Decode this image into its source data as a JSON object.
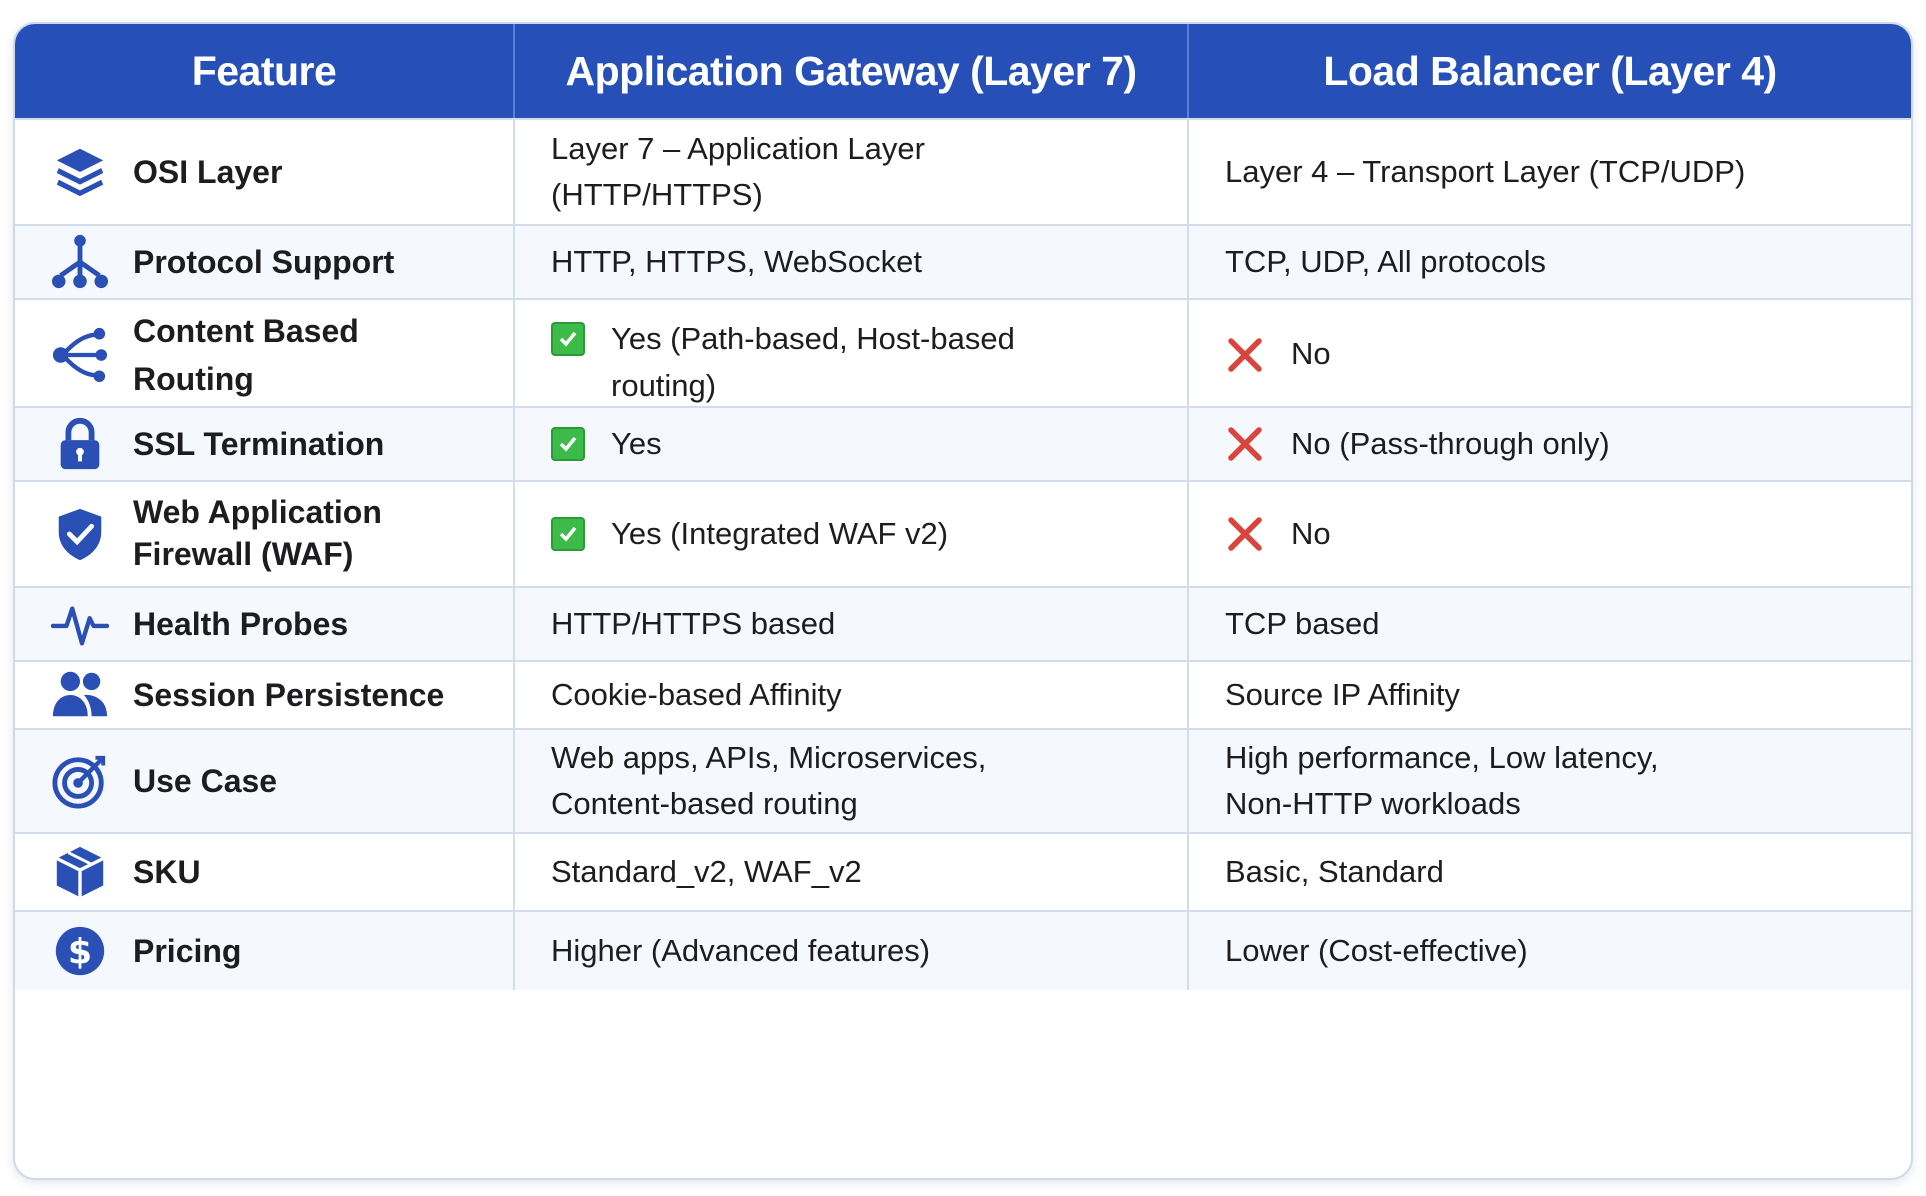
{
  "headers": {
    "feature": "Feature",
    "appgw": "Application Gateway (Layer 7)",
    "lb": "Load Balancer (Layer 4)"
  },
  "rows": [
    {
      "feature": "OSI Layer",
      "icon": "layers-icon",
      "appgw": "Layer 7 – Application Layer (HTTP/HTTPS)",
      "lb": "Layer 4 – Transport Layer (TCP/UDP)"
    },
    {
      "feature": "Protocol Support",
      "icon": "network-tree-icon",
      "appgw": "HTTP, HTTPS, WebSocket",
      "lb": "TCP, UDP, All protocols"
    },
    {
      "feature": "Content Based Routing",
      "icon": "share-nodes-icon",
      "appgw": "Yes (Path-based, Host-based routing)",
      "lb": "No"
    },
    {
      "feature": "SSL Termination",
      "icon": "lock-icon",
      "appgw": "Yes",
      "lb": "No (Pass-through only)"
    },
    {
      "feature": "Web Application Firewall (WAF)",
      "icon": "shield-check-icon",
      "appgw": "Yes (Integrated WAF v2)",
      "lb": "No"
    },
    {
      "feature": "Health Probes",
      "icon": "heartbeat-icon",
      "appgw": "HTTP/HTTPS based",
      "lb": "TCP based"
    },
    {
      "feature": "Session Persistence",
      "icon": "users-icon",
      "appgw": "Cookie-based Affinity",
      "lb": "Source IP Affinity"
    },
    {
      "feature": "Use Case",
      "icon": "target-icon",
      "appgw": "Web apps, APIs, Microservices, Content-based routing",
      "lb": "High performance, Low latency, Non-HTTP workloads"
    },
    {
      "feature": "SKU",
      "icon": "cube-icon",
      "appgw": "Standard_v2, WAF_v2",
      "lb": "Basic, Standard"
    },
    {
      "feature": "Pricing",
      "icon": "dollar-coin-icon",
      "appgw": "Higher (Advanced features)",
      "lb": "Lower (Cost-effective)"
    }
  ],
  "colors": {
    "header": "#2650b8",
    "icon": "#2a4fb5",
    "check": "#3dbb48",
    "cross": "#d9443c"
  }
}
